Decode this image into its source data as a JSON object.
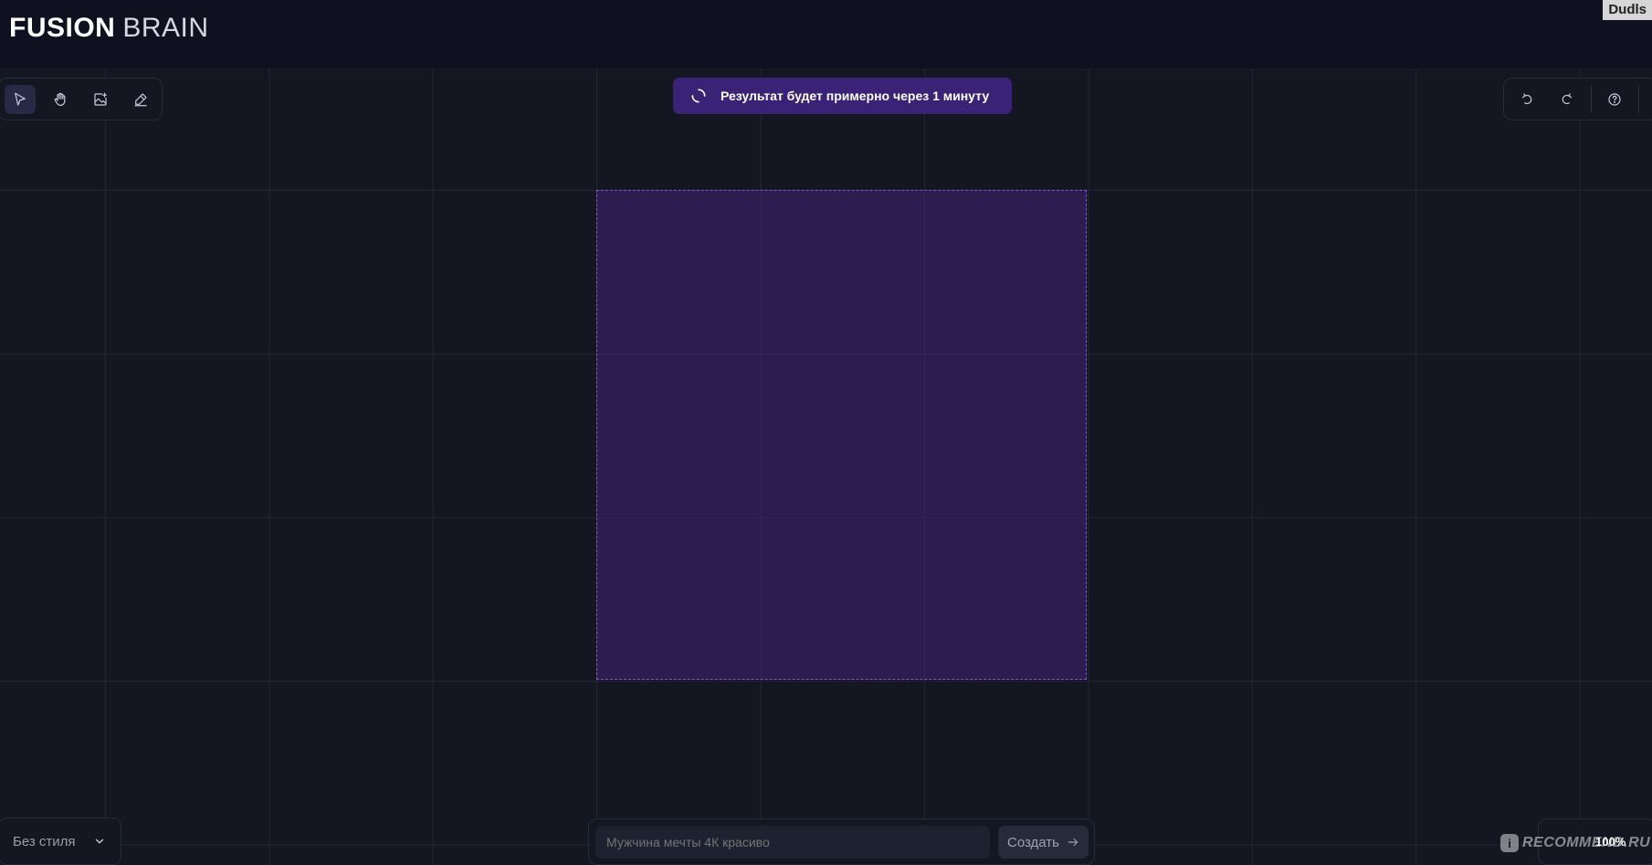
{
  "app": {
    "logo_strong": "FUSION",
    "logo_light": "BRAIN",
    "username": "Dudls"
  },
  "toolbar_left": {
    "tools": [
      {
        "name": "select",
        "icon": "cursor-arrow-icon",
        "active": true
      },
      {
        "name": "hand",
        "icon": "hand-icon",
        "active": false
      },
      {
        "name": "image",
        "icon": "image-add-icon",
        "active": false
      },
      {
        "name": "eraser",
        "icon": "eraser-icon",
        "active": false
      }
    ]
  },
  "toolbar_right": {
    "buttons": [
      {
        "name": "undo",
        "icon": "undo-icon"
      },
      {
        "name": "redo",
        "icon": "redo-icon"
      },
      {
        "name": "help",
        "icon": "help-circle-icon"
      }
    ]
  },
  "toast": {
    "text": "Результат будет примерно через 1 минуту",
    "icon": "spinner-icon"
  },
  "style_select": {
    "selected": "Без стиля",
    "icon": "chevron-down-icon"
  },
  "prompt": {
    "placeholder": "Мужчина мечты 4К красиво",
    "value": "",
    "create_label": "Создать",
    "create_icon": "arrow-right-icon"
  },
  "zoom": {
    "label": "100%"
  },
  "watermark": {
    "badge": "i",
    "text": "RECOMMEND.RU"
  },
  "colors": {
    "background": "#141622",
    "topbar": "#0f1120",
    "frame_fill": "#2e1f52",
    "frame_border": "#7a58c8",
    "toast": "#3a2377"
  }
}
